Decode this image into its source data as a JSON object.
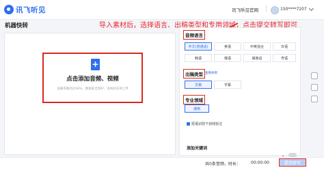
{
  "header": {
    "logo_text": "讯飞听见",
    "site_link": "讯飞听见官网",
    "user_phone": "150****7207"
  },
  "page": {
    "title": "机器快转",
    "instruction": "导入素材后，选择语言、出稿类型和专用领域，点击提交转写即可"
  },
  "upload": {
    "label": "点击添加音频、视频",
    "hint": "准确率最高达98%，数据安全保护，多格式支持上传"
  },
  "settings": {
    "language": {
      "title": "音频语言",
      "options": [
        "中文(普通话)",
        "英语",
        "中英混合",
        "日语",
        "韩语",
        "俄语",
        "闽南话",
        "粤语"
      ],
      "selected": "中文(普通话)"
    },
    "output_type": {
      "title": "出稿类型",
      "sub": "查看样例",
      "options": [
        "文稿",
        "字幕"
      ],
      "selected": "文稿"
    },
    "domain": {
      "title": "专业领域",
      "options": [
        "通用"
      ],
      "selected": "通用"
    },
    "smart_label": "短语识别下划线标注",
    "keywords_title": "添加关键词"
  },
  "footer": {
    "summary": "共0条音频，时长：",
    "duration": "00:00:00",
    "submit_label": "提交转写"
  },
  "colors": {
    "accent": "#2f6ff0",
    "annotation_red": "#d8281e"
  }
}
